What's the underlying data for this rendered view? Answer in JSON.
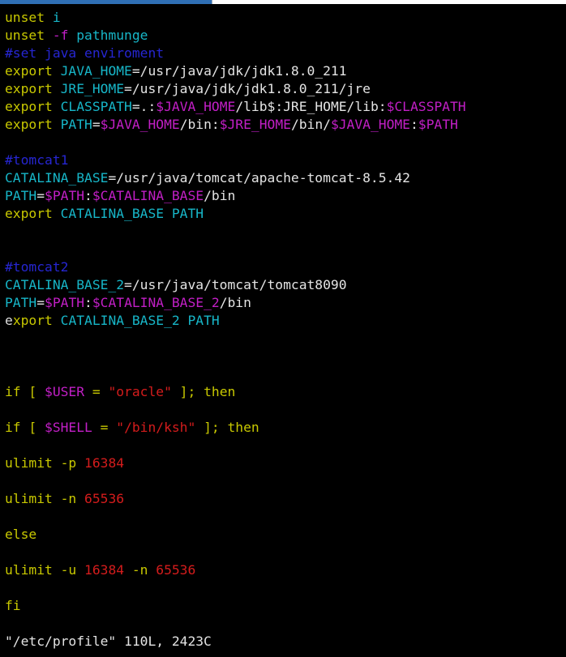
{
  "editor": {
    "lines": [
      [
        {
          "t": "unset ",
          "c": "yellow"
        },
        {
          "t": "i",
          "c": "cyan"
        }
      ],
      [
        {
          "t": "unset ",
          "c": "yellow"
        },
        {
          "t": "-f",
          "c": "magenta"
        },
        {
          "t": " pathmunge",
          "c": "cyan"
        }
      ],
      [
        {
          "t": "#set java enviroment",
          "c": "blue"
        }
      ],
      [
        {
          "t": "export ",
          "c": "yellow"
        },
        {
          "t": "JAVA_HOME",
          "c": "cyan"
        },
        {
          "t": "=/usr/java/jdk/jdk1.8.0_211",
          "c": "white"
        }
      ],
      [
        {
          "t": "export ",
          "c": "yellow"
        },
        {
          "t": "JRE_HOME",
          "c": "cyan"
        },
        {
          "t": "=/usr/java/jdk/jdk1.8.0_211/jre",
          "c": "white"
        }
      ],
      [
        {
          "t": "export ",
          "c": "yellow"
        },
        {
          "t": "CLASSPATH",
          "c": "cyan"
        },
        {
          "t": "=.:",
          "c": "white"
        },
        {
          "t": "$JAVA_HOME",
          "c": "magenta"
        },
        {
          "t": "/lib$:JRE_HOME/lib:",
          "c": "white"
        },
        {
          "t": "$CLASSPATH",
          "c": "magenta"
        }
      ],
      [
        {
          "t": "export ",
          "c": "yellow"
        },
        {
          "t": "PATH",
          "c": "cyan"
        },
        {
          "t": "=",
          "c": "white"
        },
        {
          "t": "$JAVA_HOME",
          "c": "magenta"
        },
        {
          "t": "/bin:",
          "c": "white"
        },
        {
          "t": "$JRE_HOME",
          "c": "magenta"
        },
        {
          "t": "/bin/",
          "c": "white"
        },
        {
          "t": "$JAVA_HOME",
          "c": "magenta"
        },
        {
          "t": ":",
          "c": "white"
        },
        {
          "t": "$PATH",
          "c": "magenta"
        }
      ],
      [],
      [
        {
          "t": "#tomcat1",
          "c": "blue"
        }
      ],
      [
        {
          "t": "CATALINA_BASE",
          "c": "cyan"
        },
        {
          "t": "=/usr/java/tomcat/apache-tomcat-8.5.42",
          "c": "white"
        }
      ],
      [
        {
          "t": "PATH",
          "c": "cyan"
        },
        {
          "t": "=",
          "c": "white"
        },
        {
          "t": "$PATH",
          "c": "magenta"
        },
        {
          "t": ":",
          "c": "white"
        },
        {
          "t": "$CATALINA_BASE",
          "c": "magenta"
        },
        {
          "t": "/bin",
          "c": "white"
        }
      ],
      [
        {
          "t": "export ",
          "c": "yellow"
        },
        {
          "t": "CATALINA_BASE PATH",
          "c": "cyan"
        }
      ],
      [],
      [],
      [
        {
          "t": "#tomcat2",
          "c": "blue"
        }
      ],
      [
        {
          "t": "CATALINA_BASE_2",
          "c": "cyan"
        },
        {
          "t": "=/usr/java/tomcat/tomcat8090",
          "c": "white"
        }
      ],
      [
        {
          "t": "PATH",
          "c": "cyan"
        },
        {
          "t": "=",
          "c": "white"
        },
        {
          "t": "$PATH",
          "c": "magenta"
        },
        {
          "t": ":",
          "c": "white"
        },
        {
          "t": "$CATALINA_BASE_2",
          "c": "magenta"
        },
        {
          "t": "/bin",
          "c": "white"
        }
      ],
      [
        {
          "t": "e",
          "c": "cursor"
        },
        {
          "t": "xport ",
          "c": "yellow"
        },
        {
          "t": "CATALINA_BASE_2 PATH",
          "c": "cyan"
        }
      ],
      [],
      [],
      [],
      [
        {
          "t": "if [ ",
          "c": "yellow"
        },
        {
          "t": "$USER",
          "c": "magenta"
        },
        {
          "t": " = ",
          "c": "yellow"
        },
        {
          "t": "\"oracle\"",
          "c": "red"
        },
        {
          "t": " ]; then",
          "c": "yellow"
        }
      ],
      [],
      [
        {
          "t": "if [ ",
          "c": "yellow"
        },
        {
          "t": "$SHELL",
          "c": "magenta"
        },
        {
          "t": " = ",
          "c": "yellow"
        },
        {
          "t": "\"/bin/ksh\"",
          "c": "red"
        },
        {
          "t": " ]; then",
          "c": "yellow"
        }
      ],
      [],
      [
        {
          "t": "ulimit -p ",
          "c": "yellow"
        },
        {
          "t": "16384",
          "c": "red"
        }
      ],
      [],
      [
        {
          "t": "ulimit -n ",
          "c": "yellow"
        },
        {
          "t": "65536",
          "c": "red"
        }
      ],
      [],
      [
        {
          "t": "else",
          "c": "yellow"
        }
      ],
      [],
      [
        {
          "t": "ulimit -u ",
          "c": "yellow"
        },
        {
          "t": "16384",
          "c": "red"
        },
        {
          "t": " -n ",
          "c": "yellow"
        },
        {
          "t": "65536",
          "c": "red"
        }
      ],
      [],
      [
        {
          "t": "fi",
          "c": "yellow"
        }
      ],
      [],
      [
        {
          "t": "\"/etc/profile\" 110L, 2423C",
          "c": "white"
        }
      ]
    ]
  },
  "colors": {
    "background": "#000000",
    "yellow": "#c8c800",
    "cyan": "#17b6c8",
    "magenta": "#c21fc6",
    "blue": "#2626d2",
    "red": "#d41c1c",
    "white": "#e4e4e4",
    "cursor": "#23e523"
  }
}
